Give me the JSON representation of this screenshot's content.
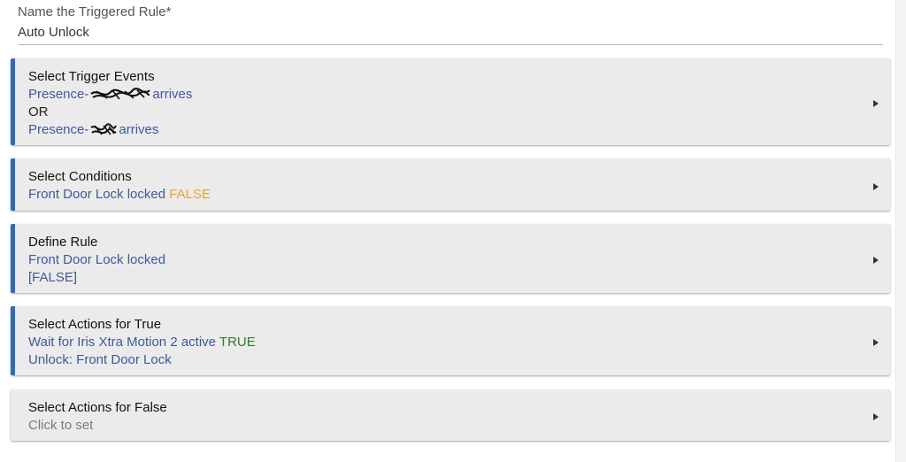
{
  "name_field": {
    "label": "Name the Triggered Rule*",
    "value": "Auto Unlock"
  },
  "cards": {
    "trigger": {
      "title": "Select Trigger Events",
      "line1_prefix": "Presence-",
      "line1_suffix": "arrives",
      "line2": "OR",
      "line3_prefix": "Presence-",
      "line3_suffix": "arrives"
    },
    "conditions": {
      "title": "Select Conditions",
      "text": "Front Door Lock locked",
      "state": "FALSE"
    },
    "define": {
      "title": "Define Rule",
      "text": "Front Door Lock locked",
      "state": "[FALSE]"
    },
    "actions_true": {
      "title": "Select Actions for True",
      "line1_text": "Wait for Iris Xtra Motion 2 active",
      "line1_state": "TRUE",
      "line2": "Unlock: Front Door Lock"
    },
    "actions_false": {
      "title": "Select Actions for False",
      "placeholder": "Click to set"
    }
  },
  "colors": {
    "accent": "#2f6db3",
    "link_text": "#3d5a9a",
    "false_state": "#f0a030",
    "true_state": "#2f7d2f",
    "card_bg": "#ebebeb"
  },
  "icons": {
    "expand": "triangle-right-icon",
    "redaction": "scribble-redaction"
  }
}
